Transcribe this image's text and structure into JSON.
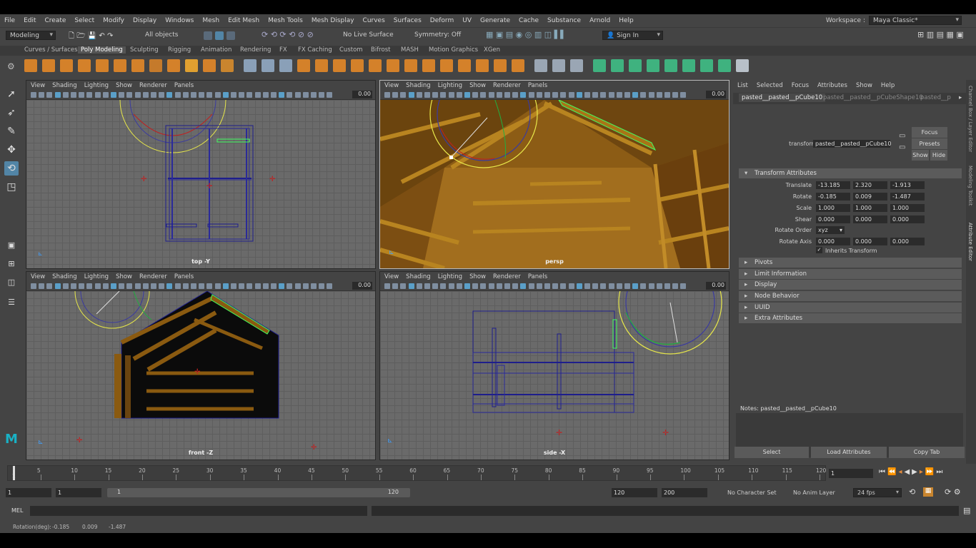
{
  "menubar": {
    "items": [
      "File",
      "Edit",
      "Create",
      "Select",
      "Modify",
      "Display",
      "Windows",
      "Mesh",
      "Edit Mesh",
      "Mesh Tools",
      "Mesh Display",
      "Curves",
      "Surfaces",
      "Deform",
      "UV",
      "Generate",
      "Cache",
      "Substance",
      "Arnold",
      "Help"
    ],
    "workspace_label": "Workspace :",
    "workspace_value": "Maya Classic*"
  },
  "statusline": {
    "mode": "Modeling",
    "selection": "All objects",
    "live_surface": "No Live Surface",
    "symmetry": "Symmetry: Off",
    "signin": "Sign In"
  },
  "shelf_tabs": [
    "Curves / Surfaces",
    "Poly Modeling",
    "Sculpting",
    "Rigging",
    "Animation",
    "Rendering",
    "FX",
    "FX Caching",
    "Custom",
    "Bifrost",
    "MASH",
    "Motion Graphics",
    "XGen"
  ],
  "shelf_active": "Poly Modeling",
  "panel_menu": [
    "View",
    "Shading",
    "Lighting",
    "Show",
    "Renderer",
    "Panels"
  ],
  "viewports": {
    "top": {
      "label": "top -Y",
      "value": "0.00"
    },
    "persp": {
      "label": "persp",
      "value": "0.00"
    },
    "front": {
      "label": "front -Z",
      "value": "0.00"
    },
    "side": {
      "label": "side -X",
      "value": "0.00"
    }
  },
  "attribute_editor": {
    "menu": [
      "List",
      "Selected",
      "Focus",
      "Attributes",
      "Show",
      "Help"
    ],
    "tabs": [
      "pasted__pasted__pCube10",
      "pasted__pasted__pCubeShape10",
      "pasted__p"
    ],
    "transform_label": "transform:",
    "transform_value": "pasted__pasted__pCube10",
    "focus_btn": "Focus",
    "presets_btn": "Presets",
    "show_btn": "Show",
    "hide_btn": "Hide",
    "section_transform": "Transform Attributes",
    "translate_label": "Translate",
    "translate": [
      "-13.185",
      "2.320",
      "-1.913"
    ],
    "rotate_label": "Rotate",
    "rotate": [
      "-0.185",
      "0.009",
      "-1.487"
    ],
    "scale_label": "Scale",
    "scale": [
      "1.000",
      "1.000",
      "1.000"
    ],
    "shear_label": "Shear",
    "shear": [
      "0.000",
      "0.000",
      "0.000"
    ],
    "rotate_order_label": "Rotate Order",
    "rotate_order": "xyz",
    "rotate_axis_label": "Rotate Axis",
    "rotate_axis": [
      "0.000",
      "0.000",
      "0.000"
    ],
    "inherits": "Inherits Transform",
    "sections": [
      "Pivots",
      "Limit Information",
      "Display",
      "Node Behavior",
      "UUID",
      "Extra Attributes"
    ],
    "notes": "Notes:  pasted__pasted__pCube10",
    "select_btn": "Select",
    "load_btn": "Load Attributes",
    "copy_btn": "Copy Tab"
  },
  "side_tabs": [
    "Channel Box / Layer Editor",
    "Modeling Toolkit",
    "Attribute Editor"
  ],
  "timeline": {
    "ticks": [
      "5",
      "10",
      "15",
      "20",
      "25",
      "30",
      "35",
      "40",
      "45",
      "50",
      "55",
      "60",
      "65",
      "70",
      "75",
      "80",
      "85",
      "90",
      "95",
      "100",
      "105",
      "110",
      "115",
      "120"
    ],
    "start_tick": "1",
    "current_frame": "1"
  },
  "range": {
    "start": "1",
    "playback_start": "1",
    "slider_start": "1",
    "slider_end": "120",
    "playback_end": "120",
    "end": "200",
    "character_set": "No Character Set",
    "anim_layer": "No Anim Layer",
    "fps": "24 fps"
  },
  "cmdline": {
    "label": "MEL"
  },
  "helpline": {
    "text": "Rotation(deg):",
    "values": [
      "-0.185",
      "0.009",
      "-1.487"
    ]
  },
  "colors": {
    "accent": "#5285a6",
    "selection_green": "#40ff60",
    "wire_blue": "#1e1e8c",
    "manip_yellow": "#e8e84a",
    "wood": "#8a5a10"
  }
}
